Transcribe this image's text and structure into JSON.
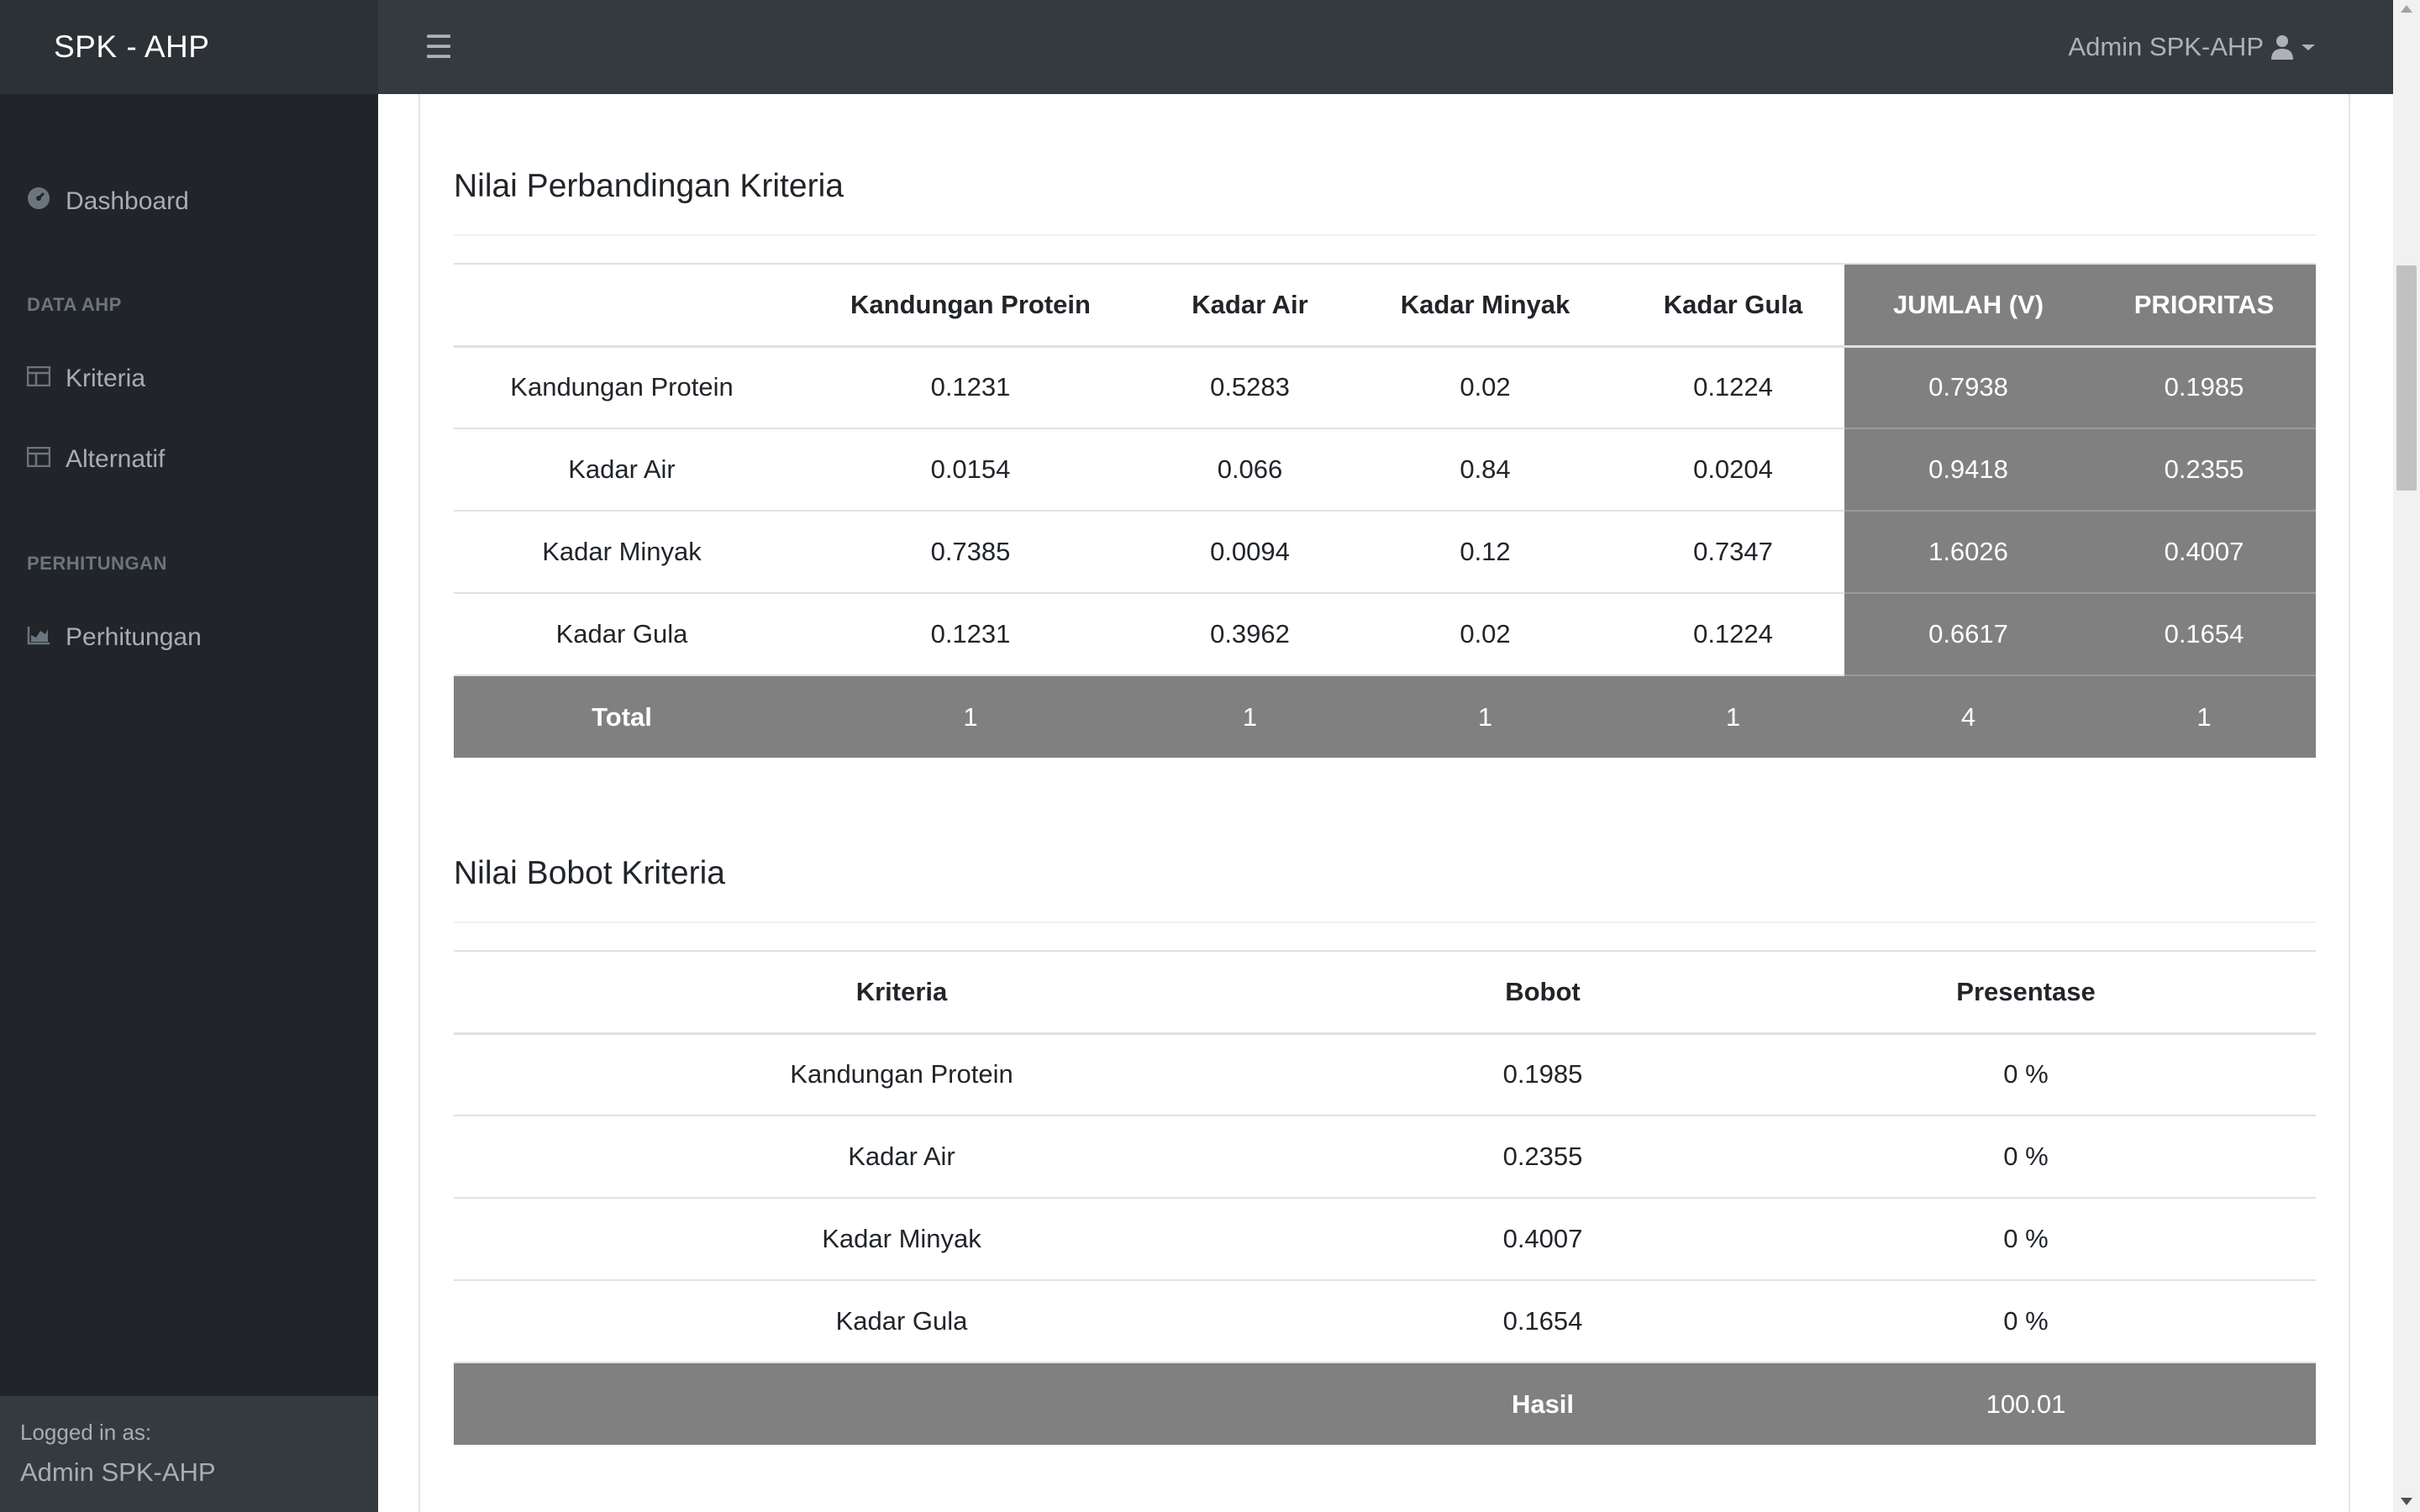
{
  "app": {
    "brand": "SPK - AHP"
  },
  "header": {
    "user_name": "Admin SPK-AHP"
  },
  "sidebar": {
    "items": [
      {
        "label": "Dashboard",
        "icon": "dashboard-icon"
      },
      {
        "label": "Kriteria",
        "icon": "table-icon"
      },
      {
        "label": "Alternatif",
        "icon": "table-icon"
      },
      {
        "label": "Perhitungan",
        "icon": "chart-area-icon"
      }
    ],
    "headings": [
      "DATA AHP",
      "PERHITUNGAN"
    ],
    "footer": {
      "logged_in_as": "Logged in as:",
      "user": "Admin SPK-AHP"
    }
  },
  "comparison": {
    "title": "Nilai Perbandingan Kriteria",
    "headers": [
      "",
      "Kandungan Protein",
      "Kadar Air",
      "Kadar Minyak",
      "Kadar Gula",
      "JUMLAH (V)",
      "PRIORITAS"
    ],
    "rows": [
      [
        "Kandungan Protein",
        "0.1231",
        "0.5283",
        "0.02",
        "0.1224",
        "0.7938",
        "0.1985"
      ],
      [
        "Kadar Air",
        "0.0154",
        "0.066",
        "0.84",
        "0.0204",
        "0.9418",
        "0.2355"
      ],
      [
        "Kadar Minyak",
        "0.7385",
        "0.0094",
        "0.12",
        "0.7347",
        "1.6026",
        "0.4007"
      ],
      [
        "Kadar Gula",
        "0.1231",
        "0.3962",
        "0.02",
        "0.1224",
        "0.6617",
        "0.1654"
      ]
    ],
    "total": [
      "Total",
      "1",
      "1",
      "1",
      "1",
      "4",
      "1"
    ]
  },
  "weights": {
    "title": "Nilai Bobot Kriteria",
    "headers": [
      "Kriteria",
      "Bobot",
      "Presentase"
    ],
    "rows": [
      [
        "Kandungan Protein",
        "0.1985",
        "0 %"
      ],
      [
        "Kadar Air",
        "0.2355",
        "0 %"
      ],
      [
        "Kadar Minyak",
        "0.4007",
        "0 %"
      ],
      [
        "Kadar Gula",
        "0.1654",
        "0 %"
      ]
    ],
    "footer": [
      "",
      "Hasil",
      "100.01"
    ]
  }
}
